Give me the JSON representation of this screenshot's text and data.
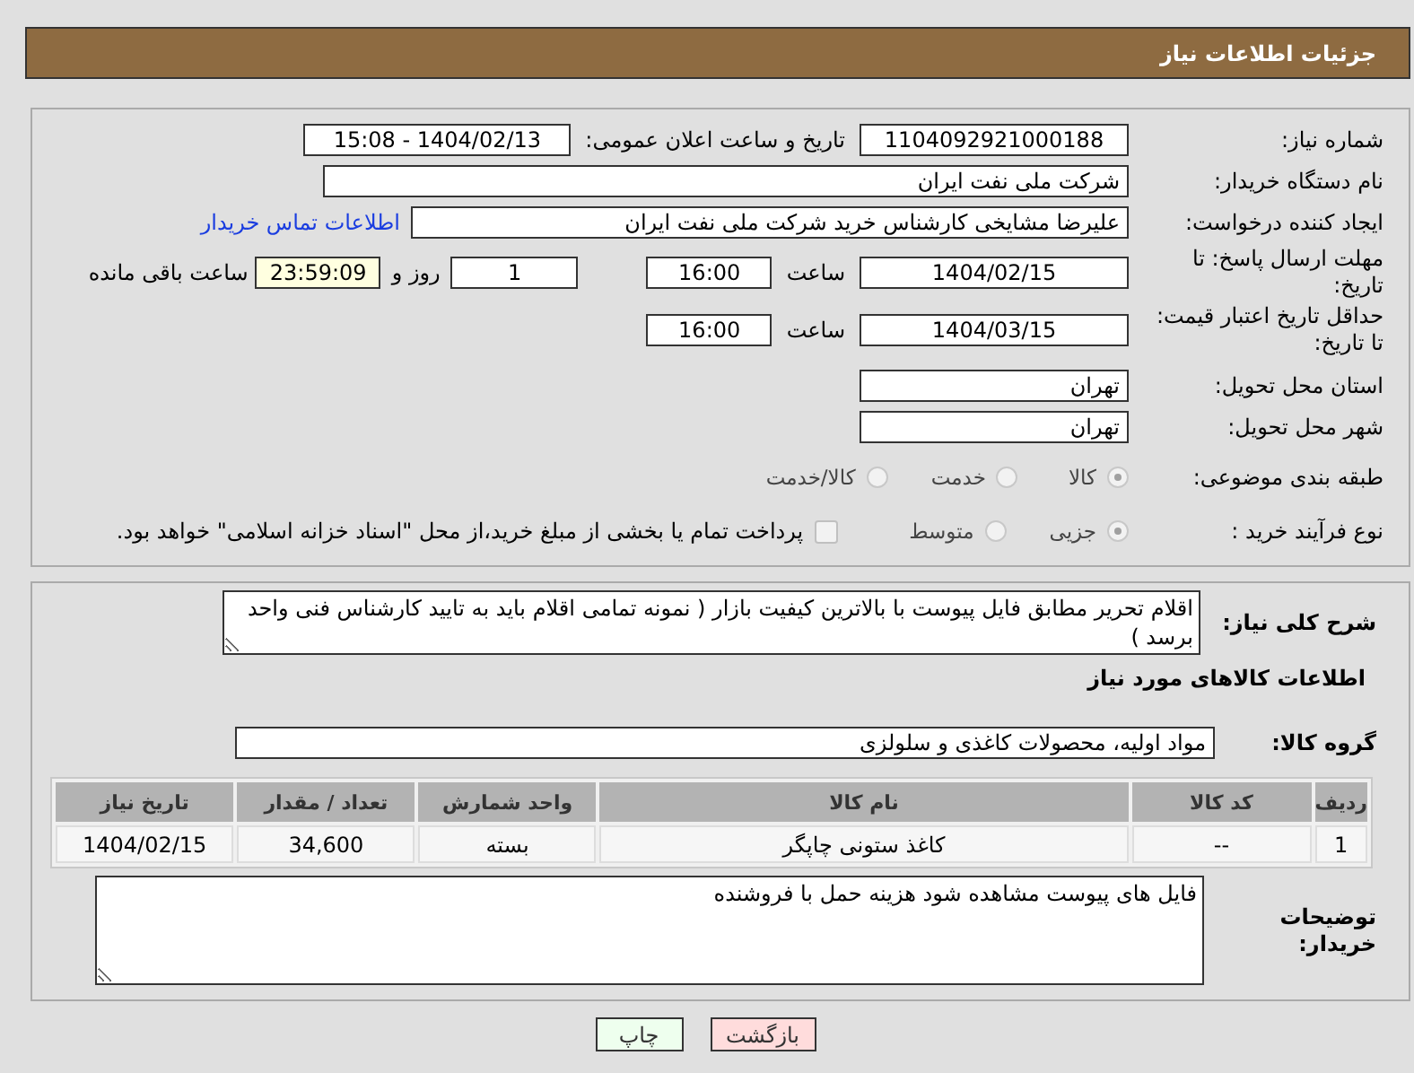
{
  "header": {
    "title": "جزئیات اطلاعات نیاز"
  },
  "need_number": {
    "label": "شماره نیاز:",
    "value": "1104092921000188"
  },
  "announce": {
    "label": "تاریخ و ساعت اعلان عمومی:",
    "value": "1404/02/13 - 15:08"
  },
  "buyer_org": {
    "label": "نام دستگاه خریدار:",
    "value": "شرکت ملی نفت ایران"
  },
  "requester": {
    "label": "ایجاد کننده درخواست:",
    "value": "علیرضا مشایخی کارشناس خرید  شرکت ملی نفت ایران",
    "link": "اطلاعات تماس خریدار"
  },
  "reply_deadline": {
    "label": "مهلت ارسال پاسخ: تا تاریخ:",
    "date": "1404/02/15",
    "time_label": "ساعت",
    "time": "16:00",
    "days": "1",
    "days_label": "روز و",
    "remaining": "23:59:09",
    "remaining_label": "ساعت باقی مانده"
  },
  "price_validity": {
    "label": "حداقل تاریخ اعتبار قیمت: تا تاریخ:",
    "date": "1404/03/15",
    "time_label": "ساعت",
    "time": "16:00"
  },
  "province": {
    "label": "استان محل تحویل:",
    "value": "تهران"
  },
  "city": {
    "label": "شهر محل تحویل:",
    "value": "تهران"
  },
  "category": {
    "label": "طبقه بندی موضوعی:",
    "options": [
      {
        "label": "کالا",
        "selected": true
      },
      {
        "label": "خدمت",
        "selected": false
      },
      {
        "label": "کالا/خدمت",
        "selected": false
      }
    ]
  },
  "process": {
    "label": "نوع فرآیند خرید :",
    "options": [
      {
        "label": "جزیی",
        "selected": true
      },
      {
        "label": "متوسط",
        "selected": false
      }
    ],
    "payment": {
      "label": "پرداخت تمام یا بخشی از مبلغ خرید،از محل \"اسناد خزانه اسلامی\" خواهد بود.",
      "checked": false
    }
  },
  "description": {
    "label": "شرح کلی نیاز:",
    "value": "اقلام تحریر مطابق فایل پیوست با بالاترین کیفیت بازار ( نمونه تمامی اقلام باید به تایید کارشناس فنی واحد برسد )"
  },
  "goods_title": "اطلاعات کالاهای مورد نیاز",
  "goods_group": {
    "label": "گروه کالا:",
    "value": "مواد اولیه، محصولات کاغذی و سلولزی"
  },
  "table": {
    "columns": [
      "ردیف",
      "کد کالا",
      "نام کالا",
      "واحد شمارش",
      "تعداد / مقدار",
      "تاریخ نیاز"
    ],
    "rows": [
      [
        "1",
        "--",
        "کاغذ ستونی چاپگر",
        "بسته",
        "34,600",
        "1404/02/15"
      ]
    ]
  },
  "buyer_notes": {
    "label": "توضیحات خریدار:",
    "value": "فایل های پیوست مشاهده شود هزینه حمل با فروشنده"
  },
  "buttons": [
    {
      "label": "بازگشت",
      "kind": "back"
    },
    {
      "label": "چاپ",
      "kind": "print"
    }
  ]
}
